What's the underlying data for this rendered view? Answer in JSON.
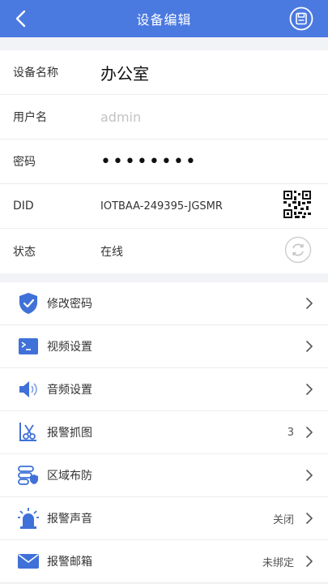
{
  "header": {
    "title": "设备编辑",
    "back_icon": "chevron-left-icon",
    "save_icon": "save-icon"
  },
  "info": {
    "name_label": "设备名称",
    "name_value": "办公室",
    "user_label": "用户名",
    "user_placeholder": "admin",
    "pass_label": "密码",
    "pass_value": "••••••••",
    "did_label": "DID",
    "did_value": "IOTBAA-249395-JGSMR",
    "status_label": "状态",
    "status_value": "在线"
  },
  "menu": [
    {
      "label": "修改密码",
      "value": "",
      "icon": "shield-check-icon"
    },
    {
      "label": "视频设置",
      "value": "",
      "icon": "terminal-icon"
    },
    {
      "label": "音频设置",
      "value": "",
      "icon": "speaker-icon"
    },
    {
      "label": "报警抓图",
      "value": "3",
      "icon": "scissors-frame-icon"
    },
    {
      "label": "区域布防",
      "value": "",
      "icon": "zone-shield-icon"
    },
    {
      "label": "报警声音",
      "value": "关闭",
      "icon": "alarm-light-icon"
    },
    {
      "label": "报警邮箱",
      "value": "未绑定",
      "icon": "mail-icon"
    }
  ],
  "colors": {
    "primary": "#4a79e0",
    "background": "#f2f3f6"
  }
}
